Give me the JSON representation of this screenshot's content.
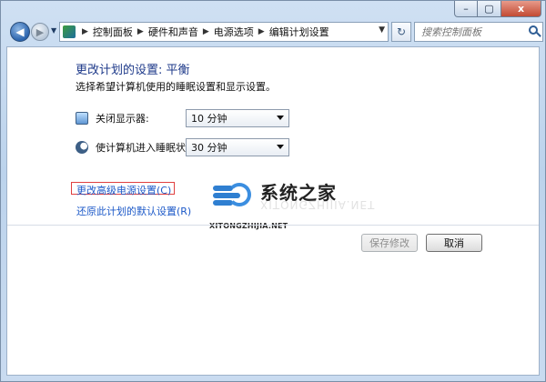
{
  "titlebar": {
    "minimize_icon": "minimize-icon",
    "maximize_icon": "maximize-icon",
    "close_icon": "close-icon",
    "minimize_glyph": "–",
    "maximize_glyph": "▢",
    "close_glyph": "x"
  },
  "address_bar": {
    "back_glyph": "◀",
    "forward_glyph": "▶",
    "history_glyph": "▼",
    "breadcrumbs": [
      "控制面板",
      "硬件和声音",
      "电源选项",
      "编辑计划设置"
    ],
    "breadcrumb_sep": "▶",
    "dropdown_glyph": "▼",
    "refresh_glyph": "↻"
  },
  "search": {
    "placeholder": "搜索控制面板"
  },
  "page": {
    "heading": "更改计划的设置: 平衡",
    "subtext": "选择希望计算机使用的睡眠设置和显示设置。",
    "display_off": {
      "label": "关闭显示器:",
      "value": "10 分钟",
      "icon": "monitor-icon"
    },
    "sleep": {
      "label": "使计算机进入睡眠状态:",
      "value": "30 分钟",
      "icon": "moon-icon"
    },
    "advanced_link": "更改高级电源设置(C)",
    "restore_link": "还原此计划的默认设置(R)",
    "save_button": "保存修改",
    "cancel_button": "取消"
  },
  "watermark": {
    "title": "系统之家",
    "url": "XITONGZHIJIA.NET",
    "reflection": "XITONGZHIJIA.NET"
  },
  "colors": {
    "link": "#1c59c8",
    "heading": "#1e3a8a",
    "highlight_box": "#e04040"
  }
}
